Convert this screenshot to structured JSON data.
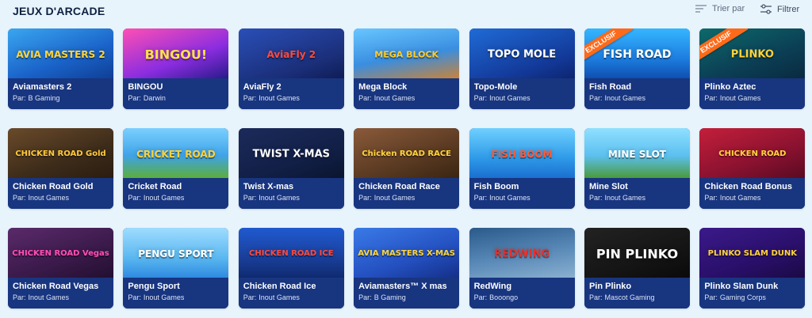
{
  "header": {
    "title": "JEUX D'ARCADE",
    "sort_label": "Trier par",
    "filter_label": "Filtrer"
  },
  "icons": {
    "sort": "sort-lines-icon",
    "filter": "sliders-filter-icon"
  },
  "colors": {
    "page_bg": "#e8f4fc",
    "card_info_bg": "#183580",
    "ribbon": "#ff6a1a"
  },
  "provider_prefix": "Par:",
  "games": [
    {
      "name": "Aviamasters 2",
      "provider": "B Gaming",
      "logo": "AVIA MASTERS 2",
      "badge": ""
    },
    {
      "name": "BINGOU",
      "provider": "Darwin",
      "logo": "BINGOU!",
      "badge": ""
    },
    {
      "name": "AviaFly 2",
      "provider": "Inout Games",
      "logo": "AviaFly 2",
      "badge": ""
    },
    {
      "name": "Mega Block",
      "provider": "Inout Games",
      "logo": "MEGA BLOCK",
      "badge": ""
    },
    {
      "name": "Topo-Mole",
      "provider": "Inout Games",
      "logo": "TOPO MOLE",
      "badge": ""
    },
    {
      "name": "Fish Road",
      "provider": "Inout Games",
      "logo": "FISH ROAD",
      "badge": "EXCLUSIF"
    },
    {
      "name": "Plinko Aztec",
      "provider": "Inout Games",
      "logo": "PLINKO",
      "badge": "EXCLUSIF"
    },
    {
      "name": "Chicken Road Gold",
      "provider": "Inout Games",
      "logo": "CHICKEN ROAD Gold",
      "badge": ""
    },
    {
      "name": "Cricket Road",
      "provider": "Inout Games",
      "logo": "CRICKET ROAD",
      "badge": ""
    },
    {
      "name": "Twist X-mas",
      "provider": "Inout Games",
      "logo": "TWIST X-MAS",
      "badge": ""
    },
    {
      "name": "Chicken Road Race",
      "provider": "Inout Games",
      "logo": "Chicken ROAD RACE",
      "badge": ""
    },
    {
      "name": "Fish Boom",
      "provider": "Inout Games",
      "logo": "FISH BOOM",
      "badge": ""
    },
    {
      "name": "Mine Slot",
      "provider": "Inout Games",
      "logo": "MINE SLOT",
      "badge": ""
    },
    {
      "name": "Chicken Road Bonus",
      "provider": "Inout Games",
      "logo": "CHICKEN ROAD",
      "badge": ""
    },
    {
      "name": "Chicken Road Vegas",
      "provider": "Inout Games",
      "logo": "CHICKEN ROAD Vegas",
      "badge": ""
    },
    {
      "name": "Pengu Sport",
      "provider": "Inout Games",
      "logo": "PENGU SPORT",
      "badge": ""
    },
    {
      "name": "Chicken Road Ice",
      "provider": "Inout Games",
      "logo": "CHICKEN ROAD ICE",
      "badge": ""
    },
    {
      "name": "Aviamasters™ X mas",
      "provider": "B Gaming",
      "logo": "AVIA MASTERS X-MAS",
      "badge": ""
    },
    {
      "name": "RedWing",
      "provider": "Booongo",
      "logo": "REDWING",
      "badge": ""
    },
    {
      "name": "Pin Plinko",
      "provider": "Mascot Gaming",
      "logo": "PIN PLINKO",
      "badge": ""
    },
    {
      "name": "Plinko Slam Dunk",
      "provider": "Gaming Corps",
      "logo": "PLINKO SLAM DUNK",
      "badge": ""
    }
  ]
}
